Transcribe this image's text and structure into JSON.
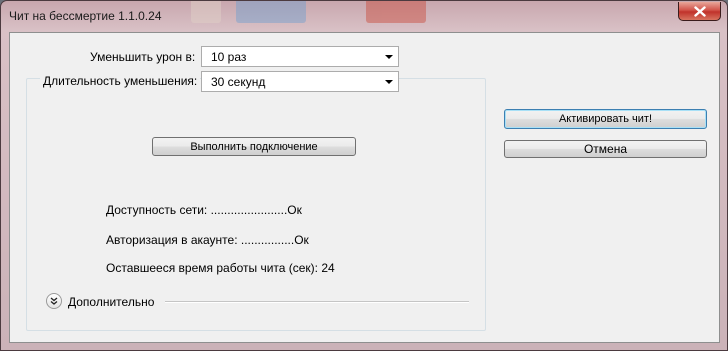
{
  "window": {
    "title": "Чит на бессмертие 1.1.0.24"
  },
  "damage": {
    "label": "Уменьшить урон в:",
    "value": "10 раз"
  },
  "duration": {
    "label": "Длительность уменьшения:",
    "value": "30 секунд"
  },
  "connect_button": "Выполнить подключение",
  "status": {
    "network": "Доступность сети: .......................Ок",
    "auth": "Авторизация в акаунте: ................Ок",
    "time_left": "Оставшееся время работы чита (сек): 24"
  },
  "more": {
    "label": "Дополнительно"
  },
  "actions": {
    "activate": "Активировать чит!",
    "cancel": "Отмена"
  },
  "colors": {
    "dialog_bg": "#f0f0f0",
    "title_glass": "#d9c1c6",
    "close_red": "#c0322b",
    "default_button_border": "#3c7fb1"
  }
}
